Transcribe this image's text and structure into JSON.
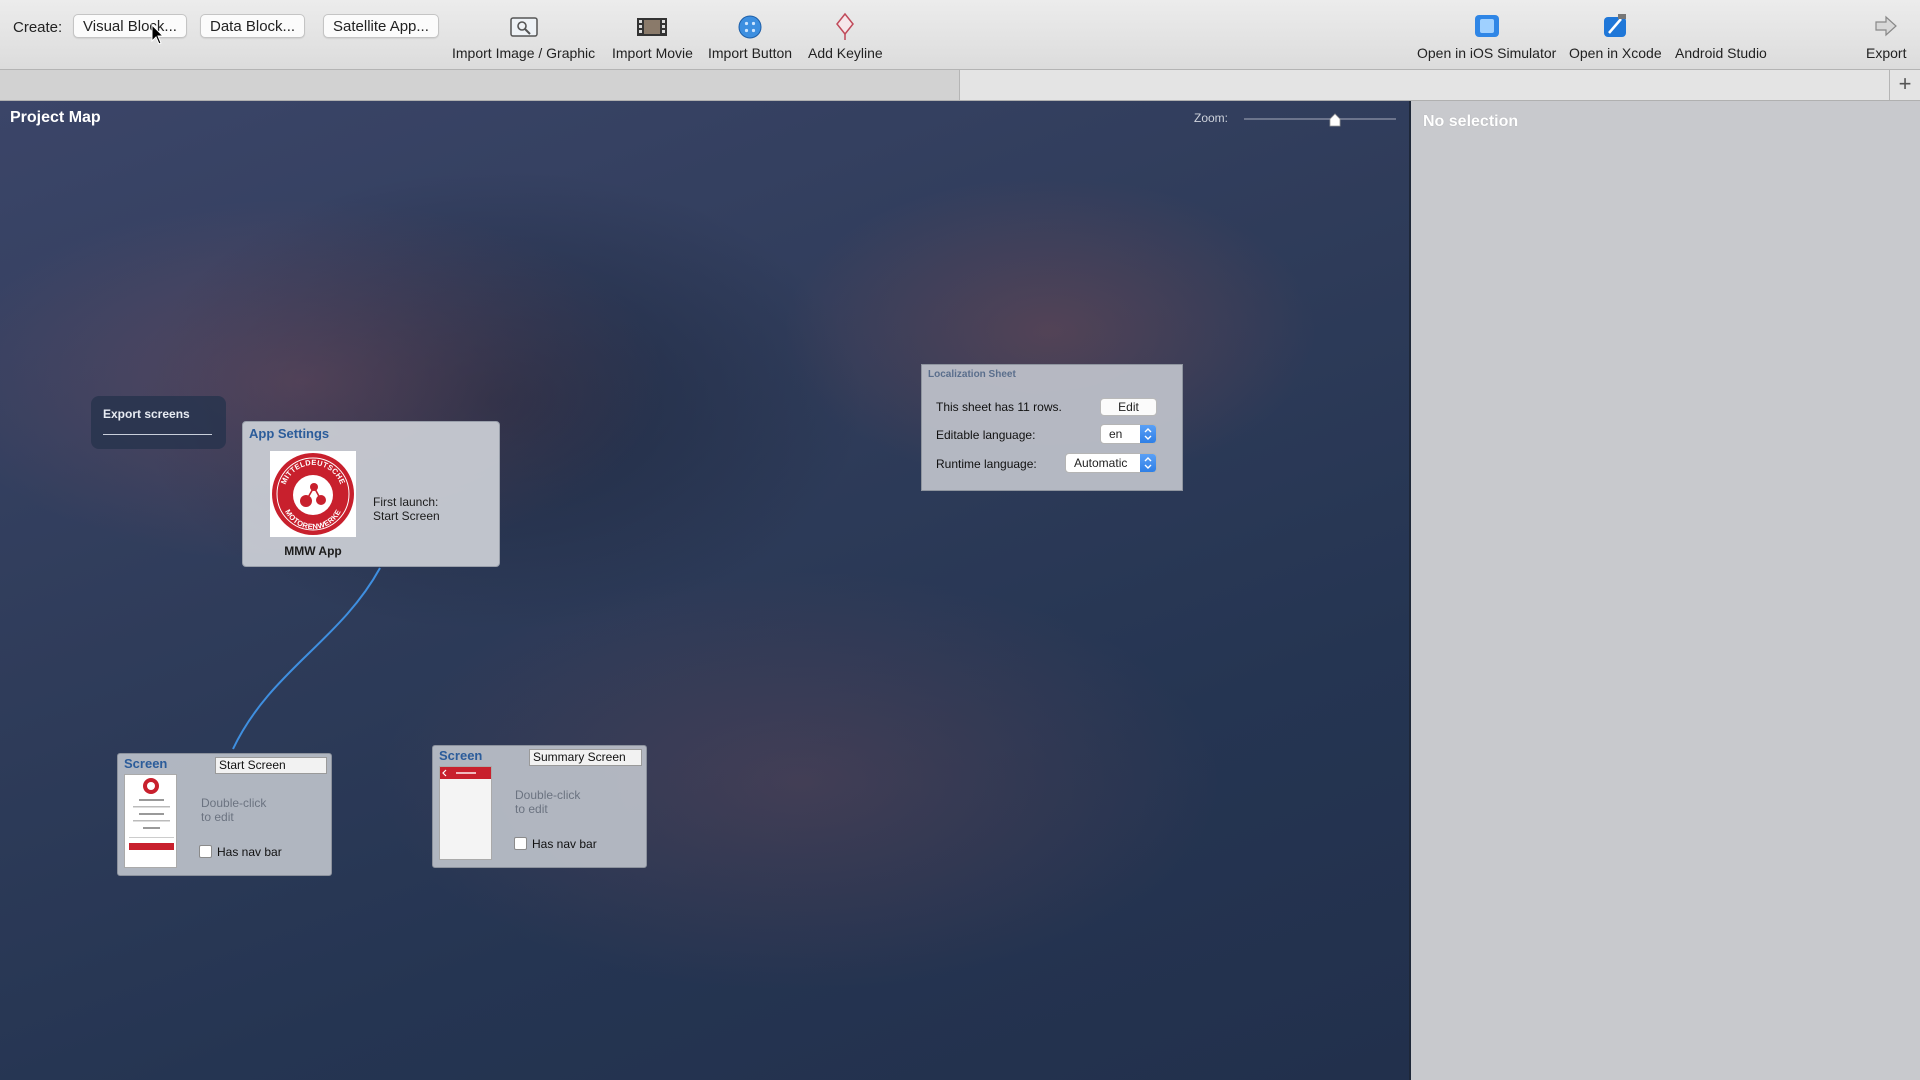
{
  "toolbar": {
    "create_label": "Create:",
    "buttons": [
      {
        "label": "Visual Block..."
      },
      {
        "label": "Data Block..."
      },
      {
        "label": "Satellite App..."
      }
    ],
    "tools": [
      {
        "label": "Import Image / Graphic",
        "icon": "image-icon"
      },
      {
        "label": "Import Movie",
        "icon": "film-icon"
      },
      {
        "label": "Import Button",
        "icon": "button-icon"
      },
      {
        "label": "Add Keyline",
        "icon": "keyline-icon"
      }
    ],
    "right_tools": [
      {
        "label": "Open in iOS Simulator",
        "icon": "simulator-icon"
      },
      {
        "label": "Open in Xcode",
        "icon": "xcode-icon"
      },
      {
        "label": "Android Studio",
        "icon": "android-studio-icon"
      },
      {
        "label": "Export",
        "icon": "export-arrow-icon"
      }
    ]
  },
  "tabstrip": {
    "plus": "+"
  },
  "canvas": {
    "title": "Project Map",
    "zoom_label": "Zoom:",
    "zoom_level": 0.6
  },
  "export_screens": {
    "title": "Export screens"
  },
  "app_settings": {
    "title": "App Settings",
    "app_name": "MMW App",
    "first_launch_label": "First launch:",
    "first_launch_value": "Start Screen",
    "logo": {
      "top_text": "MITTELDEUTSCHE",
      "bottom_text": "MOTORENWERKE"
    }
  },
  "localization_sheet": {
    "title": "Localization Sheet",
    "rows_text": "This sheet has 11 rows.",
    "edit_label": "Edit",
    "editable_language_label": "Editable language:",
    "editable_language_value": "en",
    "runtime_language_label": "Runtime language:",
    "runtime_language_value": "Automatic"
  },
  "screens": [
    {
      "type_label": "Screen",
      "name": "Start Screen",
      "hint_line1": "Double-click",
      "hint_line2": "to edit",
      "nav_bar_label": "Has nav bar",
      "has_nav_bar": false
    },
    {
      "type_label": "Screen",
      "name": "Summary Screen",
      "hint_line1": "Double-click",
      "hint_line2": "to edit",
      "nav_bar_label": "Has nav bar",
      "has_nav_bar": false
    }
  ],
  "inspector": {
    "title": "No selection"
  },
  "colors": {
    "accent_blue": "#2b5c9a",
    "brand_red": "#c8202d",
    "select_blue": "#2f7fe6"
  }
}
